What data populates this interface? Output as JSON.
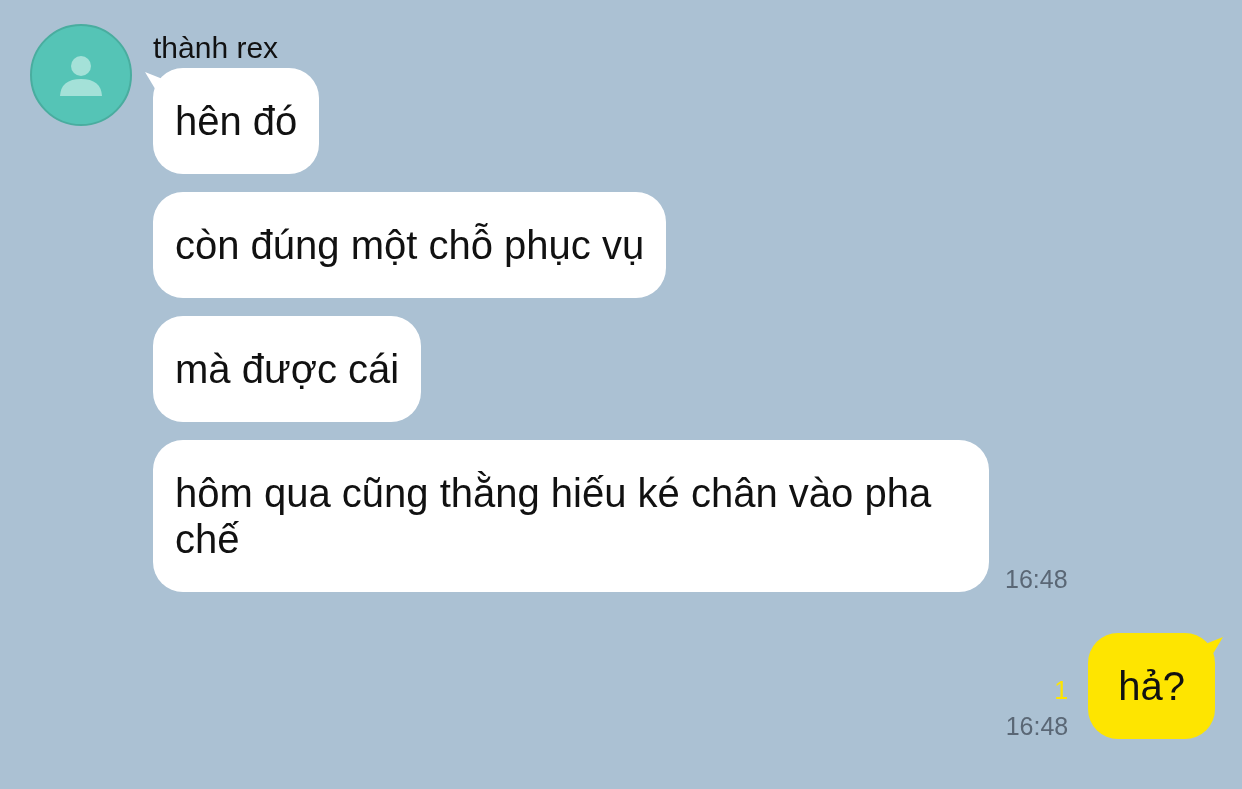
{
  "incoming": {
    "sender": "thành rex",
    "messages": [
      {
        "text": "hên đó"
      },
      {
        "text": "còn đúng một chỗ phục vụ"
      },
      {
        "text": "mà được cái"
      },
      {
        "text": "hôm qua cũng thằng hiếu ké chân vào pha chế"
      }
    ],
    "time": "16:48"
  },
  "outgoing": {
    "messages": [
      {
        "text": "hả?"
      }
    ],
    "unread": "1",
    "time": "16:48"
  }
}
